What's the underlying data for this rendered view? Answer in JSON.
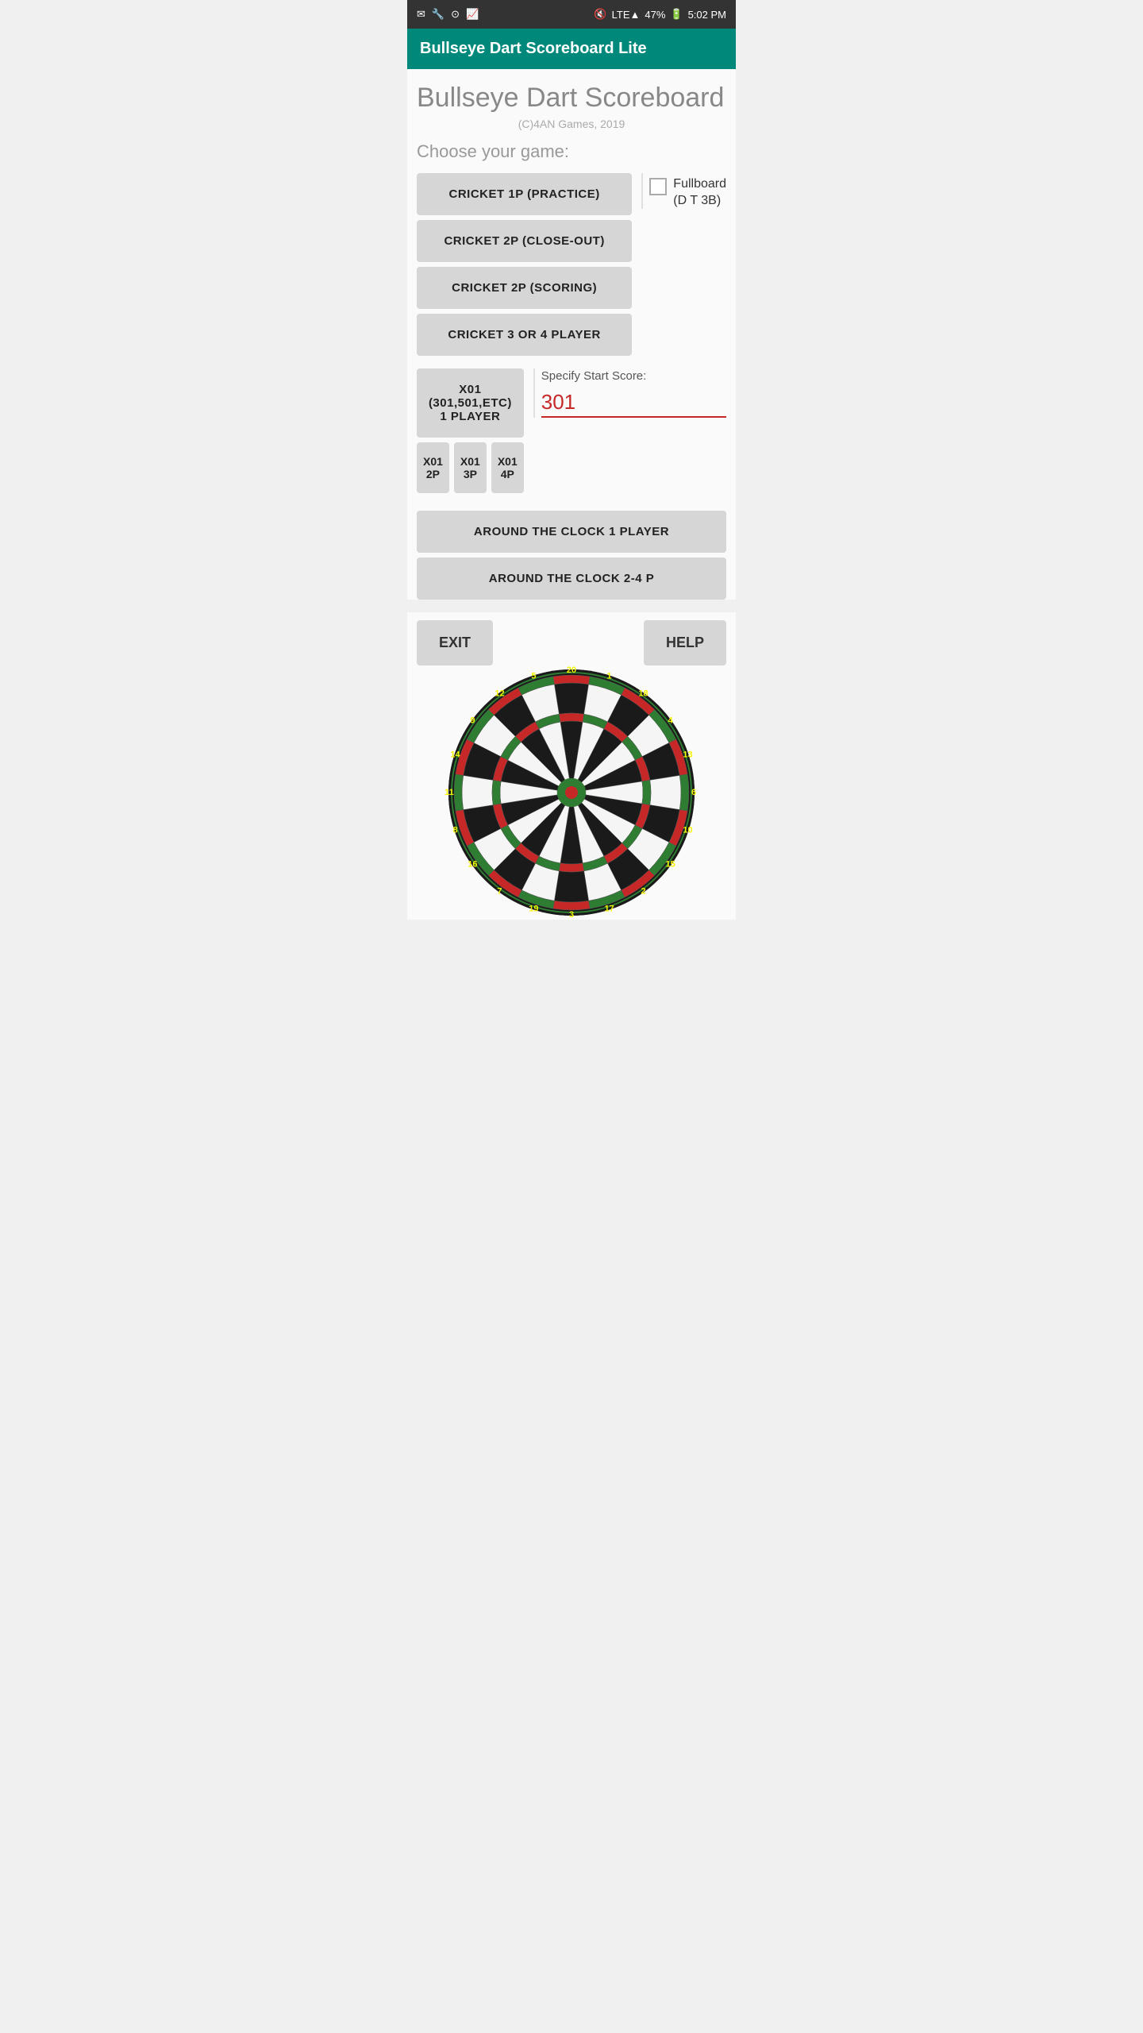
{
  "statusBar": {
    "leftIcons": [
      "email-icon",
      "wrench-icon",
      "download-icon",
      "chart-icon"
    ],
    "mute": "🔇",
    "signal": "LTE",
    "battery": "47%",
    "time": "5:02 PM"
  },
  "appBar": {
    "title": "Bullseye Dart Scoreboard Lite"
  },
  "header": {
    "title": "Bullseye Dart Scoreboard",
    "copyright": "(C)4AN Games, 2019",
    "chooseLabel": "Choose your game:"
  },
  "cricketButtons": [
    {
      "label": "CRICKET 1P (PRACTICE)",
      "id": "cricket-1p"
    },
    {
      "label": "CRICKET 2P (CLOSE-OUT)",
      "id": "cricket-2p-closeout"
    },
    {
      "label": "CRICKET 2P (SCORING)",
      "id": "cricket-2p-scoring"
    },
    {
      "label": "CRICKET 3 OR 4 PLAYER",
      "id": "cricket-3-4"
    }
  ],
  "fullboard": {
    "label": "Fullboard\n(D T 3B)",
    "checked": false
  },
  "x01Buttons": {
    "main": {
      "label": "X01 (301,501,ETC) 1 PLAYER",
      "id": "x01-1p"
    },
    "multi": [
      {
        "label": "X01 2P",
        "id": "x01-2p"
      },
      {
        "label": "X01 3P",
        "id": "x01-3p"
      },
      {
        "label": "X01 4P",
        "id": "x01-4p"
      }
    ]
  },
  "scoreInput": {
    "label": "Specify Start Score:",
    "value": "301"
  },
  "atcButtons": [
    {
      "label": "AROUND THE CLOCK 1 PLAYER",
      "id": "atc-1p"
    },
    {
      "label": "AROUND THE CLOCK 2-4 P",
      "id": "atc-2-4p"
    }
  ],
  "bottomBar": {
    "exitLabel": "EXIT",
    "helpLabel": "HELP"
  },
  "dartboard": {
    "numbers": [
      "20",
      "1",
      "18",
      "4",
      "13",
      "6",
      "10",
      "15",
      "2",
      "17",
      "3",
      "19",
      "7",
      "16",
      "8",
      "11",
      "14",
      "9",
      "12",
      "5"
    ]
  }
}
